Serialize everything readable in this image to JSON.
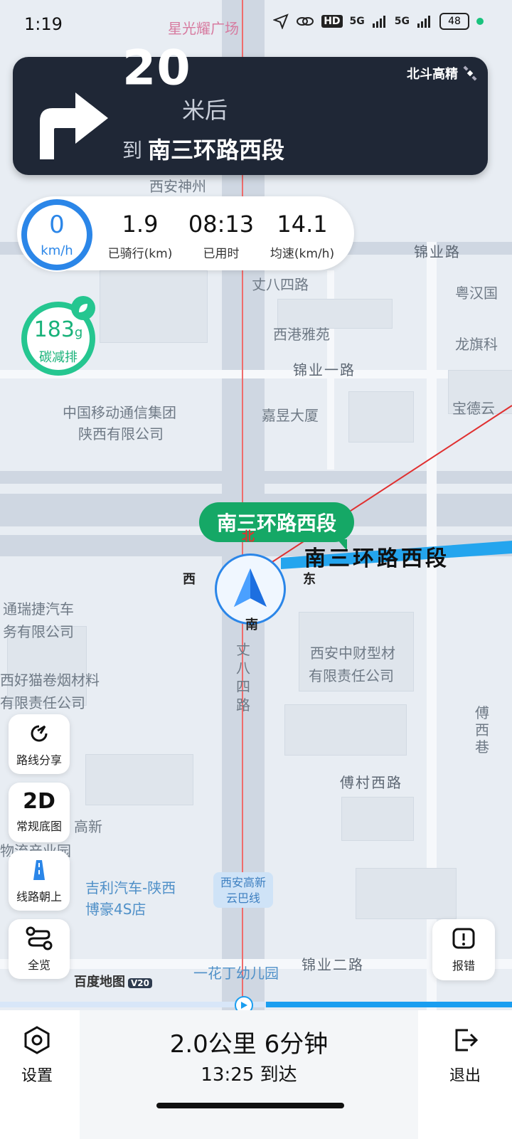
{
  "status_bar": {
    "time": "1:19",
    "network_left": "HD",
    "network_right": "5G",
    "battery": "48"
  },
  "navigation": {
    "distance": "20",
    "unit": "米后",
    "to_prefix": "到",
    "road": "南三环路西段",
    "positioning_badge": "北斗高精"
  },
  "speed": {
    "value": "0",
    "unit": "km/h"
  },
  "stats": [
    {
      "value": "1.9",
      "label": "已骑行(km)"
    },
    {
      "value": "08:13",
      "label": "已用时"
    },
    {
      "value": "14.1",
      "label": "均速(km/h)"
    }
  ],
  "carbon": {
    "value": "183",
    "unit": "g",
    "label": "碳减排"
  },
  "route": {
    "bubble": "南三环路西段",
    "current_road_label": "南三环路西段",
    "compass": {
      "n": "北",
      "s": "南",
      "w": "西",
      "e": "东"
    },
    "progress_fraction": 0.48
  },
  "map_labels": {
    "star_plaza": "星光耀广场",
    "xian_shenzhou": "西安神州",
    "jinye_road": "锦业路",
    "zhangba_4th": "丈八四路",
    "yuehan": "粤汉国",
    "xigang_yayuan": "西港雅苑",
    "longqi": "龙旗科",
    "jinye_1st": "锦业一路",
    "cmcc_1": "中国移动通信集团",
    "cmcc_2": "陕西有限公司",
    "jiayu": "嘉昱大厦",
    "baode": "宝德云",
    "tongrui_1": "通瑞捷汽车",
    "tongrui_2": "务有限公司",
    "tobacco_1": "西好猫卷烟材料",
    "tobacco_2": "有限责任公司",
    "zhongcai_1": "西安中财型材",
    "zhongcai_2": "有限责任公司",
    "zhangba_vertical": "丈八四路",
    "fuxi": "傅西巷",
    "fucun": "傅村西路",
    "gaoxin": "高新",
    "logistics": "物流产业园",
    "geely_1": "吉利汽车-陕西",
    "geely_2": "博豪4S店",
    "yunba_1": "西安高新",
    "yunba_2": "云巴线",
    "kindergarten": "一花丁幼儿园",
    "jinye_2nd": "锦业二路"
  },
  "left_buttons": [
    {
      "label": "路线分享",
      "icon": "share-refresh-icon"
    },
    {
      "big": "2D",
      "label": "常规底图"
    },
    {
      "label": "线路朝上",
      "icon": "road-up-icon"
    },
    {
      "label": "全览",
      "icon": "route-overview-icon"
    }
  ],
  "report_button": {
    "label": "报错"
  },
  "baidu": {
    "name": "百度地图",
    "version": "V20"
  },
  "bottom": {
    "summary": "2.0公里 6分钟",
    "eta": "13:25 到达",
    "settings": "设置",
    "exit": "退出"
  },
  "colors": {
    "nav_card": "#1f2736",
    "accent_blue": "#2b86e8",
    "carbon_green": "#25c690",
    "route_green": "#15a866"
  }
}
